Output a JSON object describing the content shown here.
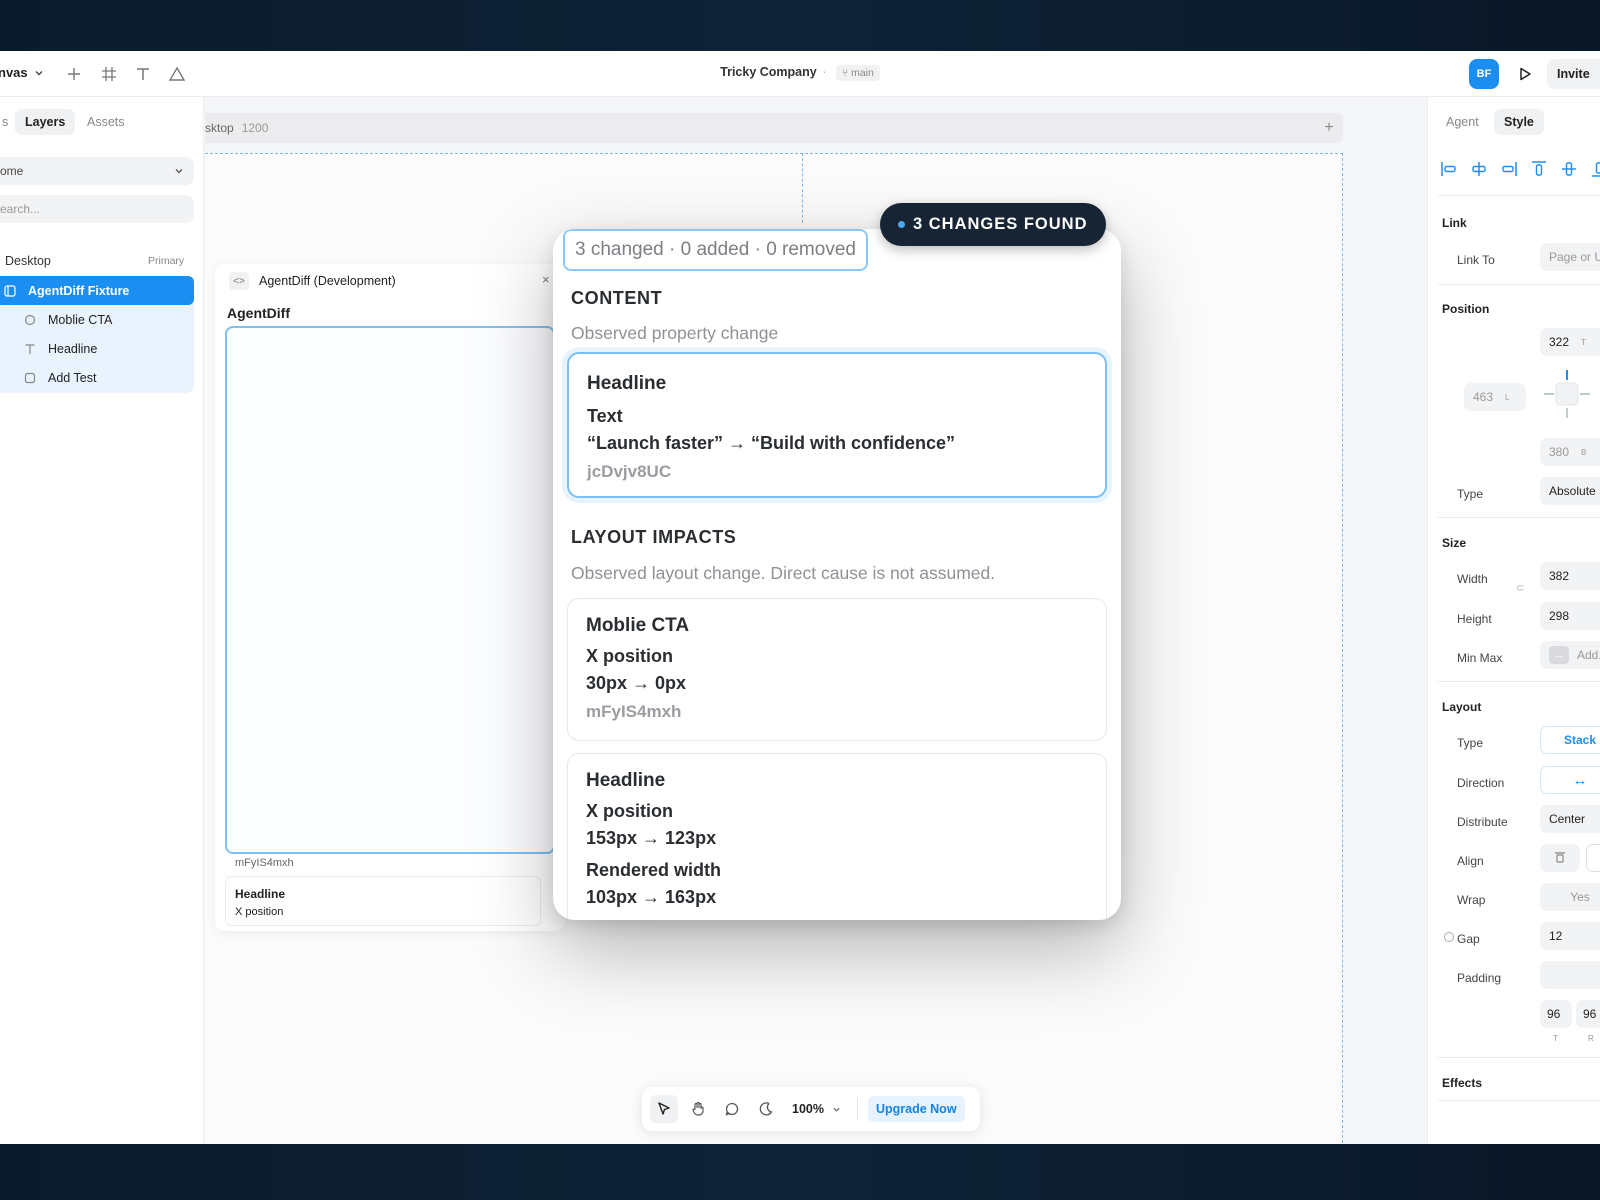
{
  "topbar": {
    "canvas_label": "nvas",
    "title": "Tricky Company",
    "separator": "·",
    "branch": "main",
    "avatar_initials": "BF",
    "invite_label": "Invite"
  },
  "left": {
    "tabs": [
      {
        "label": "s"
      },
      {
        "label": "Layers"
      },
      {
        "label": "Assets"
      }
    ],
    "page_select": "ome",
    "search_placeholder": "earch...",
    "section_title": "Desktop",
    "section_tag": "Primary",
    "layers": [
      {
        "label": "AgentDiff Fixture",
        "icon": "frame-icon"
      },
      {
        "label": "Moblie CTA",
        "icon": "circle-icon"
      },
      {
        "label": "Headline",
        "icon": "text-icon"
      },
      {
        "label": "Add Test",
        "icon": "square-icon"
      }
    ]
  },
  "canvas": {
    "frame_name": "sktop",
    "frame_width": "1200",
    "bg_panel_title": "AgentDiff (Development)",
    "bg_heading": "AgentDiff",
    "bg_id": "mFyIS4mxh",
    "bg_card_title": "Headline",
    "bg_card_sub": "X position"
  },
  "toolbar": {
    "zoom": "100%",
    "upgrade_label": "Upgrade Now"
  },
  "right": {
    "tabs": [
      {
        "label": "Agent"
      },
      {
        "label": "Style"
      }
    ],
    "link": {
      "title": "Link",
      "link_to_label": "Link To",
      "link_to_placeholder": "Page or U"
    },
    "position": {
      "title": "Position",
      "top": "322",
      "top_unit": "T",
      "left": "463",
      "left_unit": "L",
      "bottom": "380",
      "bottom_unit": "B",
      "type_label": "Type",
      "type_value": "Absolute"
    },
    "size": {
      "title": "Size",
      "width_label": "Width",
      "width_value": "382",
      "height_label": "Height",
      "height_value": "298",
      "minmax_label": "Min Max",
      "minmax_value": "Add..."
    },
    "layout": {
      "title": "Layout",
      "type_label": "Type",
      "type_value": "Stack",
      "direction_label": "Direction",
      "direction_value": "↔",
      "distribute_label": "Distribute",
      "distribute_value": "Center",
      "align_label": "Align",
      "wrap_label": "Wrap",
      "wrap_value": "Yes",
      "gap_label": "Gap",
      "gap_value": "12",
      "padding_label": "Padding",
      "pad_t": "96",
      "pad_r": "96",
      "pad_t_unit": "T",
      "pad_r_unit": "R"
    },
    "effects_title": "Effects"
  },
  "overlay": {
    "badge": "3 CHANGES FOUND",
    "summary": "3 changed · 0 added · 0 removed",
    "content_title": "CONTENT",
    "content_desc": "Observed property change",
    "content_card": {
      "title": "Headline",
      "prop": "Text",
      "change": "“Launch faster” → “Build with confidence”",
      "id": "jcDvjv8UC"
    },
    "layout_title": "LAYOUT IMPACTS",
    "layout_desc": "Observed layout change. Direct cause is not assumed.",
    "layout_cards": [
      {
        "title": "Moblie CTA",
        "prop": "X position",
        "change": "30px → 0px",
        "id": "mFyIS4mxh"
      },
      {
        "title": "Headline",
        "prop": "X position",
        "change": "153px → 123px",
        "prop2": "Rendered width",
        "change2": "103px → 163px"
      }
    ]
  }
}
